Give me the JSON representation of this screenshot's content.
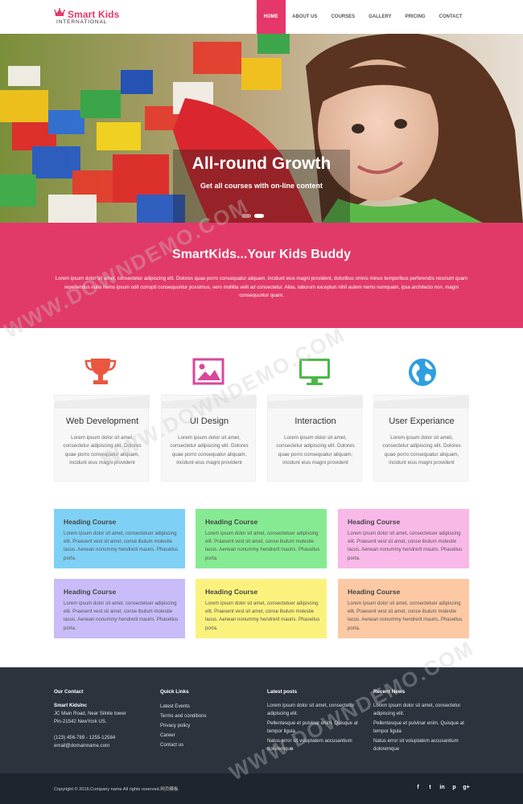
{
  "brand": {
    "name": "Smart Kids",
    "sub": "INTERNATIONAL",
    "accent": "#e6376a"
  },
  "nav": {
    "items": [
      {
        "label": "HOME",
        "active": true
      },
      {
        "label": "ABOUT US",
        "active": false
      },
      {
        "label": "COURSES",
        "active": false
      },
      {
        "label": "GALLERY",
        "active": false
      },
      {
        "label": "PRICING",
        "active": false
      },
      {
        "label": "CONTACT",
        "active": false
      }
    ]
  },
  "hero": {
    "title": "All-round Growth",
    "subtitle": "Get all courses with on-line content",
    "slide_count": 2,
    "active_slide": 2
  },
  "buddy": {
    "title": "SmartKids...Your Kids Buddy",
    "text": "Lorem ipsum dolor sit amet, consectetur adipiscing elit. Dolores quae porro consequatur aliquam, incidunt eius magni provident, doloribus omnis minus temporibus perferendis nesciunt quam repellendus nulla nemo ipsum odit corrupti consequuntur possimus, vero mollitia velit ad consectetur. Alias, laborum excepturi nihil autem nemo numquam, ipsa architecto non, magni consequuntur quam.",
    "color": "#e23a68"
  },
  "services": [
    {
      "title": "Web Development",
      "icon": "trophy-icon",
      "color": "#e9573f",
      "text": "Lorem ipsum dolor sit amet, consectetur adipiscing elit. Dolores quae porro consequatur aliquam, incidunt eius magni provident"
    },
    {
      "title": "UI Design",
      "icon": "image-icon",
      "color": "#d9479c",
      "text": "Lorem ipsum dolor sit amet, consectetur adipiscing elit. Dolores quae porro consequatur aliquam, incidunt eius magni provident"
    },
    {
      "title": "Interaction",
      "icon": "monitor-icon",
      "color": "#4cb848",
      "text": "Lorem ipsum dolor sit amet, consectetur adipiscing elit. Dolores quae porro consequatur aliquam, incidunt eius magni provident"
    },
    {
      "title": "User Experiance",
      "icon": "globe-icon",
      "color": "#2e9fe0",
      "text": "Lorem ipsum dolor sit amet, consectetur adipiscing elit. Dolores quae porro consequatur aliquam, incidunt eius magni provident"
    }
  ],
  "courses": [
    {
      "title": "Heading Course",
      "color": "#7fd0f5",
      "text": "Lorem ipsum dolor sit amet, consectetuer adipiscing elit. Praesent vest sit amet, conse ibulum molestie lacus. Aenean nonummy hendrerit mauris. Phasellus porta."
    },
    {
      "title": "Heading Course",
      "color": "#86ea93",
      "text": "Lorem ipsum dolor sit amet, consectetuer adipiscing elit. Praesent vest sit amet, conse ibulum molestie lacus. Aenean nonummy hendrerit mauris. Phasellus porta."
    },
    {
      "title": "Heading Course",
      "color": "#f8b8e8",
      "text": "Lorem ipsum dolor sit amet, consectetuer adipiscing elit. Praesent vest sit amet, conse ibulum molestie lacus. Aenean nonummy hendrerit mauris. Phasellus porta."
    },
    {
      "title": "Heading Course",
      "color": "#c9bcf9",
      "text": "Lorem ipsum dolor sit amet, consectetuer adipiscing elit. Praesent vest sit amet, conse ibulum molestie lacus. Aenean nonummy hendrerit mauris. Phasellus porta."
    },
    {
      "title": "Heading Course",
      "color": "#fbf27e",
      "text": "Lorem ipsum dolor sit amet, consectetuer adipiscing elit. Praesent vest sit amet, conse ibulum molestie lacus. Aenean nonummy hendrerit mauris. Phasellus porta."
    },
    {
      "title": "Heading Course",
      "color": "#fcc9a4",
      "text": "Lorem ipsum dolor sit amet, consectetuer adipiscing elit. Praesent vest sit amet, conse ibulum molestie lacus. Aenean nonummy hendrerit mauris. Phasellus porta."
    }
  ],
  "footer": {
    "contact": {
      "heading": "Our Contact",
      "company": "Smart KidsInc",
      "address1": "JC Main Road, Near Silnile tower",
      "address2": "Pin-21542 NewYork US.",
      "phone": "(123) 456-789 - 1255-12584",
      "email": "email@domainname.com"
    },
    "links": {
      "heading": "Quick Links",
      "items": [
        "Latest Events",
        "Terms and conditions",
        "Privacy policy",
        "Career",
        "Contact us"
      ]
    },
    "posts": {
      "heading": "Latest posts",
      "items": [
        "Lorem ipsum dolor sit amet, consectetur adipiscing elit.",
        "Pellentesque et pulvinar enim. Quisque at tempor ligula",
        "Natus error sit voluptatem accusantium doloremque"
      ]
    },
    "news": {
      "heading": "Recent News",
      "items": [
        "Lorem ipsum dolor sit amet, consectetur adipiscing elit.",
        "Pellentesque et pulvinar enim. Quisque at tempor ligula",
        "Natus error sit voluptatem accusantium doloremque"
      ]
    },
    "copyright": "Copyright © 2016.Company name All rights reserved.网页模板",
    "socials": [
      {
        "icon": "facebook-icon",
        "glyph": "f"
      },
      {
        "icon": "twitter-icon",
        "glyph": "t"
      },
      {
        "icon": "linkedin-icon",
        "glyph": "in"
      },
      {
        "icon": "pinterest-icon",
        "glyph": "p"
      },
      {
        "icon": "googleplus-icon",
        "glyph": "g+"
      }
    ]
  },
  "watermark": "WWW.DOWNDEMO.COM"
}
